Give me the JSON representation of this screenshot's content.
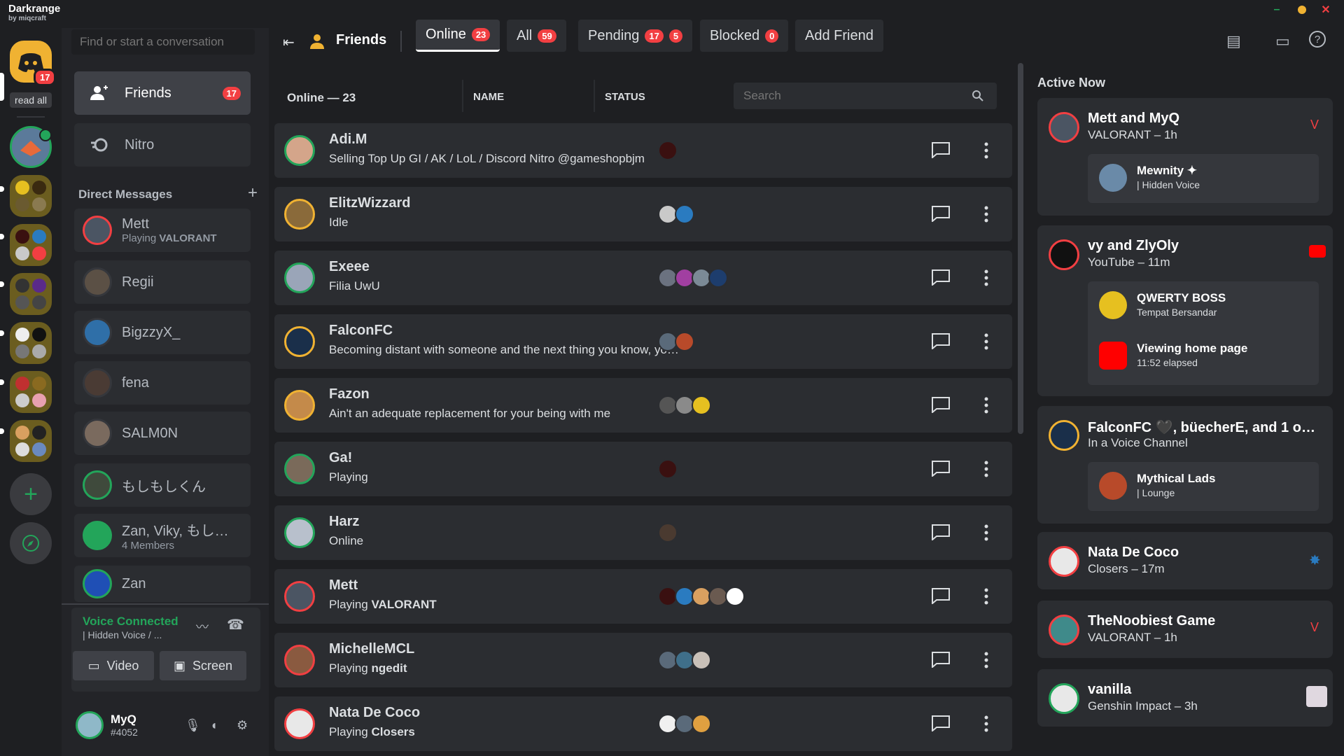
{
  "brand": {
    "name": "Darkrange",
    "byline": "by miqcraft"
  },
  "rail": {
    "home_badge": "17",
    "read_all": "read all"
  },
  "sidebar": {
    "search_placeholder": "Find or start a conversation",
    "friends_label": "Friends",
    "friends_badge": "17",
    "nitro_label": "Nitro",
    "dm_header": "Direct Messages",
    "dms": [
      {
        "name": "Mett",
        "activity_prefix": "Playing ",
        "activity": "VALORANT",
        "color": "#4b5563"
      },
      {
        "name": "Regii",
        "color": "#5b5045"
      },
      {
        "name": "BigzzyX_",
        "color": "#2f6fa8"
      },
      {
        "name": "fena",
        "color": "#4a3b34"
      },
      {
        "name": "SALM0N",
        "color": "#7a6a5e"
      },
      {
        "name": "もしもしくん",
        "color": "#3f4a3c"
      },
      {
        "name": "Zan, Viky, もし…",
        "members": "4 Members",
        "color": "#23a55a"
      },
      {
        "name": "Zan",
        "color": "#1f4fb5"
      }
    ],
    "voice": {
      "title": "Voice Connected",
      "channel": "| Hidden Voice / ...",
      "video": "Video",
      "screen": "Screen"
    },
    "user": {
      "name": "MyQ",
      "tag": "#4052"
    }
  },
  "main": {
    "header": {
      "title": "Friends"
    },
    "tabs": [
      {
        "label": "Online",
        "badge": "23"
      },
      {
        "label": "All",
        "badge": "59"
      },
      {
        "label": "Pending",
        "badge": "17",
        "badge2": "5"
      },
      {
        "label": "Blocked",
        "badge": "0"
      },
      {
        "label": "Add Friend"
      }
    ],
    "columns": {
      "count": "Online — 23",
      "name": "NAME",
      "status": "STATUS",
      "search_placeholder": "Search"
    },
    "friends": [
      {
        "name": "Adi.M",
        "status": "Selling Top Up GI / AK / LoL / Discord Nitro @gameshopbjm",
        "color": "#d4a58a",
        "acts": [
          "#3a1010"
        ]
      },
      {
        "name": "ElitzWizzard",
        "status": "Idle",
        "color": "#8a6a3a",
        "acts": [
          "#c9c9c9",
          "#2a7bc0"
        ]
      },
      {
        "name": "Exeee",
        "status": "Filia UwU",
        "color": "#9aa5b8",
        "acts": [
          "#6b7280",
          "#a13fa1",
          "#7b8a96",
          "#1d3d6d"
        ]
      },
      {
        "name": "FalconFC",
        "status": "Becoming distant with someone and the next thing you know, yo…",
        "color": "#1a2f4a",
        "acts": [
          "#5a6a7a",
          "#b84a2a"
        ]
      },
      {
        "name": "Fazon",
        "status": "Ain't an adequate replacement for your being with me",
        "color": "#c48a4a",
        "acts": [
          "#555",
          "#8a8a8a",
          "#e6c020"
        ]
      },
      {
        "name": "Ga!",
        "status": "Playing",
        "color": "#7a6a5a",
        "acts": [
          "#3a1010"
        ]
      },
      {
        "name": "Harz",
        "status": "Online",
        "color": "#b8c0cc",
        "acts": [
          "#4a3a30"
        ]
      },
      {
        "name": "Mett",
        "status_prefix": "Playing ",
        "status": "VALORANT",
        "color": "#4b5563",
        "acts": [
          "#3a1010",
          "#2a7bc0",
          "#d9a060",
          "#6a5a50",
          "#ffffff"
        ]
      },
      {
        "name": "MichelleMCL",
        "status_prefix": "Playing ",
        "status": "ngedit",
        "color": "#8a5a40",
        "acts": [
          "#5a6a7a",
          "#3f6f8a",
          "#c9c0b8"
        ]
      },
      {
        "name": "Nata De Coco",
        "status_prefix": "Playing ",
        "status": "Closers",
        "color": "#e8e8e8",
        "acts": [
          "#f0f0f0",
          "#5a6a7a",
          "#e0a040"
        ]
      }
    ]
  },
  "active": {
    "title": "Active Now",
    "cards": [
      {
        "name": "Mett and MyQ",
        "sub": "VALORANT – 1h",
        "inner": [
          {
            "t1": "Mewnity ✦",
            "t2": "| Hidden Voice"
          }
        ]
      },
      {
        "name": "vy and ZlyOly",
        "sub": "YouTube – 11m",
        "inner": [
          {
            "t1": "QWERTY BOSS",
            "t2": "Tempat Bersandar"
          },
          {
            "t1": "Viewing home page",
            "t2": "11:52 elapsed"
          }
        ]
      },
      {
        "name": "FalconFC 🖤, büecherE, and 1 o…",
        "sub": "In a Voice Channel",
        "inner": [
          {
            "t1": "Mythical Lads",
            "t2": "| Lounge"
          }
        ]
      },
      {
        "name": "Nata De Coco",
        "sub": "Closers – 17m"
      },
      {
        "name": "TheNoobiest Game",
        "sub": "VALORANT – 1h"
      },
      {
        "name": "vanilla",
        "sub": "Genshin Impact – 3h"
      }
    ]
  },
  "colors": {
    "accent": "#f0b232",
    "danger": "#f23f42",
    "online": "#23a55a",
    "bg": "#1e1f22"
  }
}
